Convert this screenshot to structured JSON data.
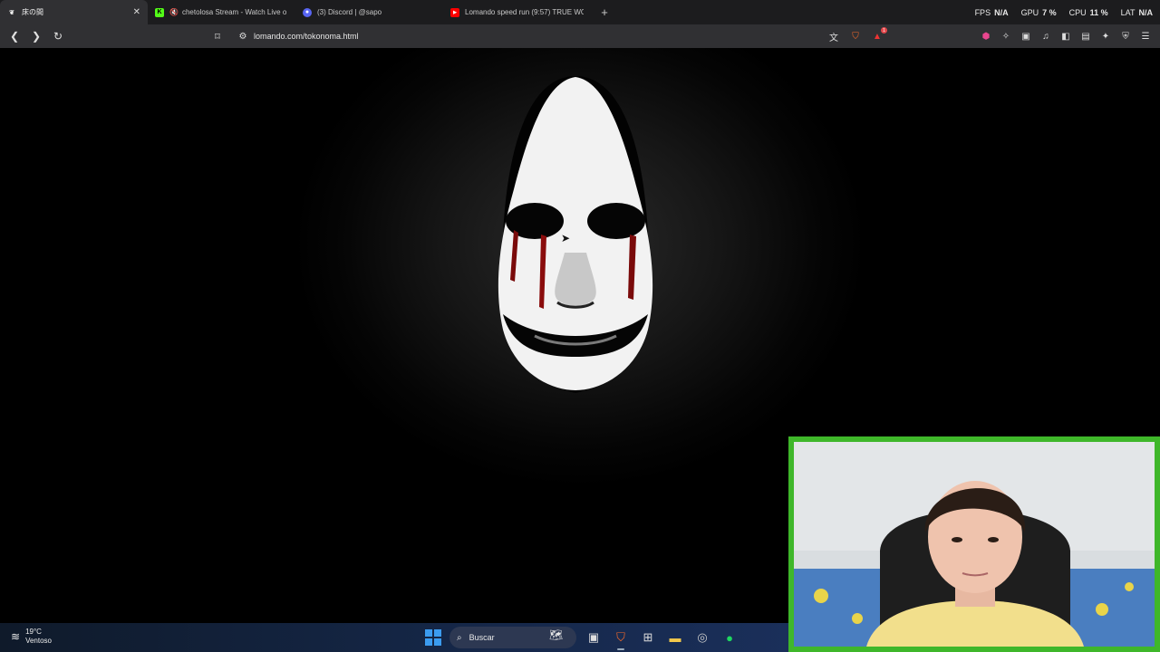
{
  "browser": {
    "tabs": [
      {
        "title": "床の間",
        "favicon": "cat-icon",
        "active": true
      },
      {
        "title": "chetolosa Stream - Watch Live o",
        "favicon": "kick-icon",
        "active": false,
        "muted": true
      },
      {
        "title": "(3) Discord | @sapo",
        "favicon": "discord-icon",
        "active": false
      },
      {
        "title": "Lomando speed run (9:57) TRUE WO",
        "favicon": "youtube-icon",
        "active": false
      }
    ],
    "new_tab_label": "+",
    "stats": {
      "fps_label": "FPS",
      "fps_value": "N/A",
      "gpu_label": "GPU",
      "gpu_value": "7 %",
      "cpu_label": "CPU",
      "cpu_value": "11 %",
      "lat_label": "LAT",
      "lat_value": "N/A"
    },
    "url": "lomando.com/tokonoma.html",
    "alert_badge": "1",
    "colors": {
      "brave": "#f86a2a",
      "accent_green": "#3fb72a"
    }
  },
  "taskbar": {
    "weather_temp": "19°C",
    "weather_desc": "Ventoso",
    "search_placeholder": "Buscar"
  }
}
